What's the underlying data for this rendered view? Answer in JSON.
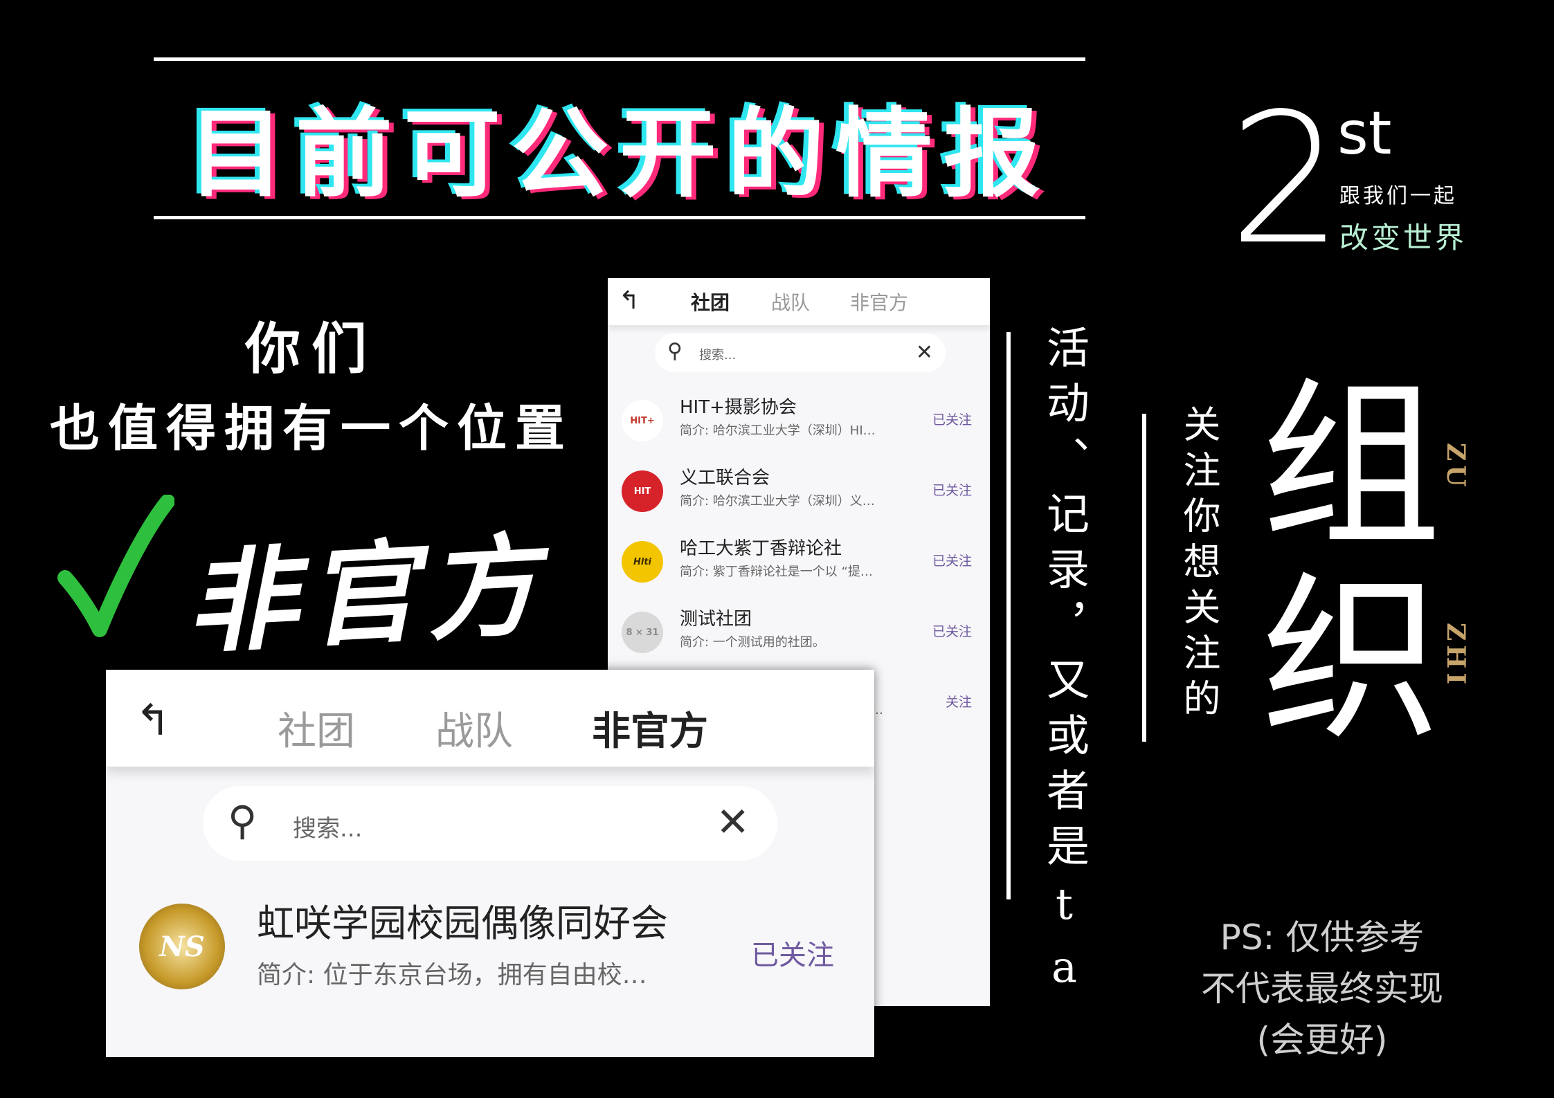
{
  "headline": "目前可公开的情报",
  "badge": {
    "num": "2",
    "suffix": "st",
    "line1": "跟我们一起",
    "line2": "改变世界"
  },
  "left": {
    "line1": "你们",
    "line2": "也值得拥有一个位置",
    "tag": "非官方",
    "check_color": "#2fbf3e"
  },
  "vertical_activity": "活动、记录，又或者是ta",
  "vertical_follow": "关注你想关注的",
  "big_title": [
    "组",
    "织"
  ],
  "pinyin": [
    "ZU",
    "ZHI"
  ],
  "ps_lines": [
    "PS: 仅供参考",
    "不代表最终实现",
    "(会更好)"
  ],
  "screen_small": {
    "tabs": [
      "社团",
      "战队",
      "非官方"
    ],
    "active_tab": "社团",
    "search_placeholder": "搜索...",
    "items": [
      {
        "logo": "HIT+",
        "logo_color": "#c0392b",
        "logo_bg": "#ffffff",
        "name": "HIT+摄影协会",
        "desc": "简介: 哈尔滨工业大学（深圳）HI…",
        "follow": "已关注"
      },
      {
        "logo": "HIT",
        "logo_color": "#ffffff",
        "logo_bg": "#d6232a",
        "name": "义工联合会",
        "desc": "简介: 哈尔滨工业大学（深圳）义…",
        "follow": "已关注"
      },
      {
        "logo": "Hlti",
        "logo_color": "#3a2a00",
        "logo_bg": "#f2c500",
        "name": "哈工大紫丁香辩论社",
        "desc": "简介: 紫丁香辩论社是一个以 “提…",
        "follow": "已关注"
      },
      {
        "logo": "8 × 31",
        "logo_color": "#8a8a8a",
        "logo_bg": "#d9d9d9",
        "name": "测试社团",
        "desc": "简介: 一个测试用的社团。",
        "follow": "已关注"
      },
      {
        "logo": "",
        "logo_color": "#ffffff",
        "logo_bg": "#f7f6f9",
        "name": "",
        "desc": "…",
        "follow": "关注"
      }
    ]
  },
  "screen_large": {
    "tabs": [
      "社团",
      "战队",
      "非官方"
    ],
    "active_tab": "非官方",
    "search_placeholder": "搜索...",
    "item": {
      "logo": "NS",
      "name": "虹咲学园校园偶像同好会",
      "desc": "简介: 位于东京台场，拥有自由校…",
      "follow": "已关注"
    }
  },
  "colors": {
    "accent_purple": "#6f5aa0",
    "gold": "#c6a46a",
    "mint": "#b8efd2"
  }
}
